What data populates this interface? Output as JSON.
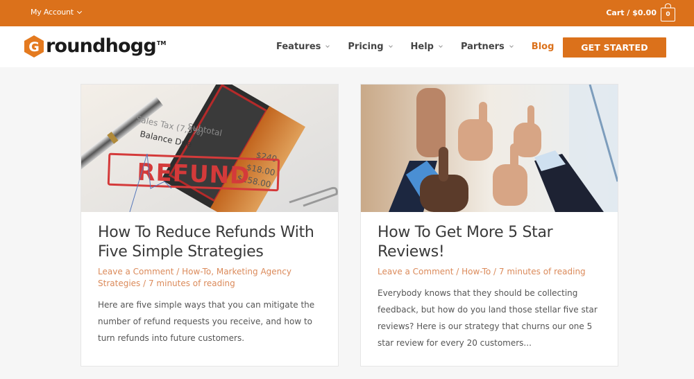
{
  "topbar": {
    "account_label": "My Account",
    "cart_label": "Cart / $0.00",
    "cart_count": "0"
  },
  "header": {
    "logo_text": "roundhogg",
    "logo_letter": "G",
    "logo_tm": "TM",
    "nav": [
      {
        "label": "Features",
        "has_dropdown": true
      },
      {
        "label": "Pricing",
        "has_dropdown": true
      },
      {
        "label": "Help",
        "has_dropdown": true
      },
      {
        "label": "Partners",
        "has_dropdown": true
      },
      {
        "label": "Blog",
        "has_dropdown": false,
        "active": true
      }
    ],
    "cta_label": "GET STARTED"
  },
  "colors": {
    "brand": "#db711b",
    "meta_link": "#db8a5a",
    "background": "#f6f6f6"
  },
  "posts": [
    {
      "image_alt": "Refund stamp on invoice",
      "image_words": {
        "stamp": "REFUND",
        "subtotal": "Subtotal",
        "tax": "Sales Tax (7,5%)",
        "balance": "Balance Due",
        "v1": "$240",
        "v2": "$18.00",
        "v3": "$258.00"
      },
      "title": "How To Reduce Refunds With Five Simple Strategies",
      "meta": {
        "comment": "Leave a Comment",
        "sep1": " / ",
        "categories": [
          "How-To",
          "Marketing Agency Strategies"
        ],
        "sep2": " / ",
        "reading": "7 minutes of reading"
      },
      "excerpt": "Here are five simple ways that you can mitigate the number of refund requests you receive, and how to turn refunds into future customers."
    },
    {
      "image_alt": "Group of thumbs up",
      "title": "How To Get More 5 Star Reviews!",
      "meta": {
        "comment": "Leave a Comment",
        "sep1": " / ",
        "categories": [
          "How-To"
        ],
        "sep2": " / ",
        "reading": "7 minutes of reading"
      },
      "excerpt": "Everybody knows that they should be collecting feedback, but how do you land those stellar five star reviews? Here is our strategy that churns our one 5 star review for every 20 customers..."
    }
  ]
}
